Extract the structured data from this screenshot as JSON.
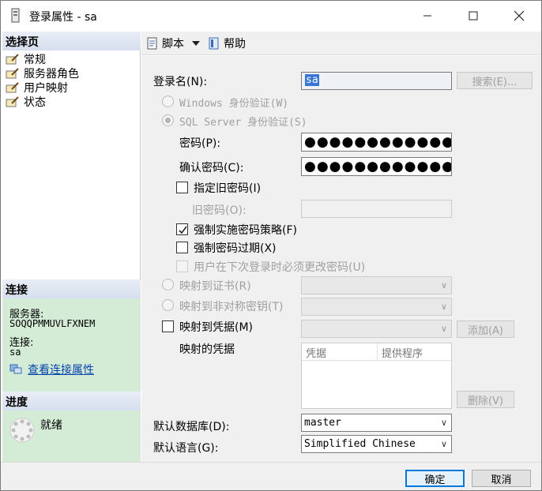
{
  "window": {
    "title": "登录属性 - sa"
  },
  "left": {
    "select_page_header": "选择页",
    "pages": [
      {
        "label": "常规"
      },
      {
        "label": "服务器角色"
      },
      {
        "label": "用户映射"
      },
      {
        "label": "状态"
      }
    ],
    "connection_header": "连接",
    "server_label": "服务器:",
    "server_value": "SOQQPMMUVLFXNEM",
    "connection_label": "连接:",
    "connection_value": "sa",
    "view_connection_link": "查看连接属性",
    "progress_header": "进度",
    "progress_status": "就绪"
  },
  "toolbar": {
    "script_label": "脚本",
    "help_label": "帮助"
  },
  "form": {
    "login_name_label": "登录名(N):",
    "login_name_value": "sa",
    "search_button": "搜索(E)...",
    "windows_auth": "Windows 身份验证(W)",
    "sql_auth": "SQL Server 身份验证(S)",
    "password_label": "密码(P):",
    "password_value": "●●●●●●●●●●●●●●●",
    "confirm_password_label": "确认密码(C):",
    "confirm_password_value": "●●●●●●●●●●●●●●●",
    "specify_old_password": "指定旧密码(I)",
    "old_password_label": "旧密码(O):",
    "enforce_policy": "强制实施密码策略(F)",
    "enforce_policy_checked": true,
    "enforce_expiration": "强制密码过期(X)",
    "must_change": "用户在下次登录时必须更改密码(U)",
    "map_certificate": "映射到证书(R)",
    "map_asymmetric_key": "映射到非对称密钥(T)",
    "map_credential": "映射到凭据(M)",
    "add_button": "添加(A)",
    "mapped_credentials_label": "映射的凭据",
    "credentials_columns": [
      "凭据",
      "提供程序"
    ],
    "remove_button": "删除(V)",
    "default_database_label": "默认数据库(D):",
    "default_database_value": "master",
    "default_language_label": "默认语言(G):",
    "default_language_value": "Simplified Chinese"
  },
  "footer": {
    "ok_button": "确定",
    "cancel_button": "取消"
  }
}
